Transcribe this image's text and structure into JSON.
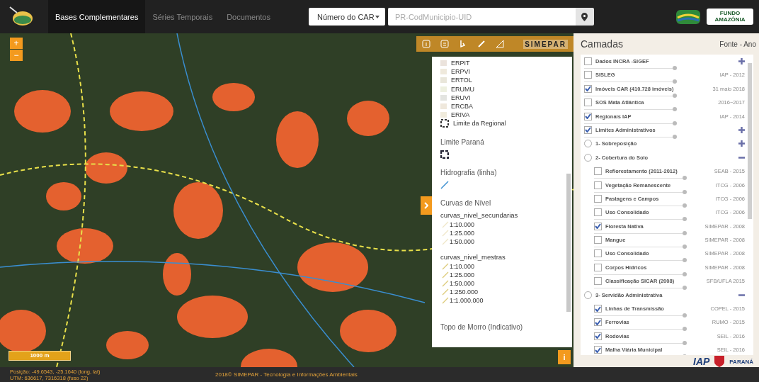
{
  "header": {
    "tabs": [
      {
        "label": "Bases Complementares",
        "selected": true
      },
      {
        "label": "Séries Temporais",
        "selected": false
      },
      {
        "label": "Documentos",
        "selected": false
      }
    ],
    "search_type": "Número do CAR",
    "search": {
      "placeholder": "PR-CodMunicipio-UID"
    },
    "partner_logo": "FUNDO AMAZÔNIA"
  },
  "map": {
    "zoom_in": "+",
    "zoom_out": "−",
    "toolbar_logo": "SIMEPAR",
    "scale": "1000 m",
    "info": "i"
  },
  "legend": {
    "regional_items": [
      {
        "label": "ERPIT",
        "color": "#ebe3dc"
      },
      {
        "label": "ERPVI",
        "color": "#efe9dc"
      },
      {
        "label": "ERTOL",
        "color": "#e9e6da"
      },
      {
        "label": "ERUMU",
        "color": "#eef0e0"
      },
      {
        "label": "ERUVI",
        "color": "#e3e4e0"
      },
      {
        "label": "ERCBA",
        "color": "#efe8dc"
      },
      {
        "label": "ERIVA",
        "color": "#f0ebdc"
      }
    ],
    "regional_limit": "Limite da Regional",
    "sections": [
      {
        "title": "Limite Paraná",
        "kind": "boundary"
      },
      {
        "title": "Hidrografia (linha)",
        "kind": "line"
      }
    ],
    "curves_title": "Curvas de Nível",
    "curve_groups": [
      {
        "name": "curvas_nivel_secundarias",
        "scales": [
          "1:10.000",
          "1:25.000",
          "1:50.000"
        ]
      },
      {
        "name": "curvas_nivel_mestras",
        "scales": [
          "1:10.000",
          "1:25.000",
          "1:50.000",
          "1:250.000",
          "1:1.000.000"
        ]
      }
    ],
    "last_title": "Topo de Morro (Indicativo)"
  },
  "layers": {
    "title": "Camadas",
    "column": "Fonte - Ano",
    "items": [
      {
        "kind": "checkbox",
        "label": "Dados INCRA -SIGEF",
        "checked": false,
        "expanded": false,
        "level": 1
      },
      {
        "kind": "checkbox",
        "label": "SISLEG",
        "checked": false,
        "source": "IAP - 2012",
        "level": 1
      },
      {
        "kind": "checkbox",
        "label": "Imóveis CAR (410.728 imóveis)",
        "checked": true,
        "source": "31 maio 2018",
        "level": 1
      },
      {
        "kind": "checkbox",
        "label": "SOS Mata Atlântica",
        "checked": false,
        "source": "2016~2017",
        "level": 1
      },
      {
        "kind": "checkbox",
        "label": "Regionais IAP",
        "checked": true,
        "source": "IAP - 2014",
        "level": 1
      },
      {
        "kind": "checkbox",
        "label": "Limites Administrativos",
        "checked": true,
        "expanded": false,
        "level": 1
      },
      {
        "kind": "radio",
        "label": "1- Sobreposição",
        "checked": false,
        "expanded": false
      },
      {
        "kind": "radio",
        "label": "2- Cobertura do Solo",
        "checked": false,
        "expanded": true,
        "children": [
          {
            "kind": "checkbox",
            "label": "Reflorestamento (2011-2012)",
            "checked": false,
            "source": "SEAB - 2015",
            "level": 1
          },
          {
            "kind": "checkbox",
            "label": "Vegetação Remanescente",
            "checked": false,
            "source": "ITCG - 2006",
            "level": 1
          },
          {
            "kind": "checkbox",
            "label": "Pastagens e Campos",
            "checked": false,
            "source": "ITCG - 2006",
            "level": 1
          },
          {
            "kind": "checkbox",
            "label": "Uso Consolidado",
            "checked": false,
            "source": "ITCG - 2006",
            "level": 1
          },
          {
            "kind": "checkbox",
            "label": "Floresta Nativa",
            "checked": true,
            "source": "SIMEPAR - 2008",
            "level": 1
          },
          {
            "kind": "checkbox",
            "label": "Mangue",
            "checked": false,
            "source": "SIMEPAR - 2008",
            "level": 1
          },
          {
            "kind": "checkbox",
            "label": "Uso Consolidado",
            "checked": false,
            "source": "SIMEPAR - 2008",
            "level": 1
          },
          {
            "kind": "checkbox",
            "label": "Corpos Hídricos",
            "checked": false,
            "source": "SIMEPAR - 2008",
            "level": 1
          },
          {
            "kind": "checkbox",
            "label": "Classificação SICAR (2008)",
            "checked": false,
            "source": "SFB/UFLA 2015",
            "level": 1
          }
        ]
      },
      {
        "kind": "radio",
        "label": "3- Servidão Administrativa",
        "checked": false,
        "expanded": true,
        "children": [
          {
            "kind": "checkbox",
            "label": "Linhas de Transmissão",
            "checked": true,
            "source": "COPEL - 2015",
            "level": 1
          },
          {
            "kind": "checkbox",
            "label": "Ferrovias",
            "checked": true,
            "source": "RUMO - 2015",
            "level": 1
          },
          {
            "kind": "checkbox",
            "label": "Rodovias",
            "checked": true,
            "source": "SEIL - 2016",
            "level": 1
          },
          {
            "kind": "checkbox",
            "label": "Malha Viária Municipal",
            "checked": true,
            "source": "SEIL - 2016",
            "level": 1
          }
        ]
      }
    ]
  },
  "footer": {
    "position": "Posição: -49.6543, -25.1640 (long, lat)",
    "utm": "UTM: 636617, 7316318 (fuso 22)",
    "copyright": "2018© SIMEPAR - Tecnologia e Informações Ambientais",
    "logos": [
      "IAP",
      "PARANÁ"
    ]
  }
}
